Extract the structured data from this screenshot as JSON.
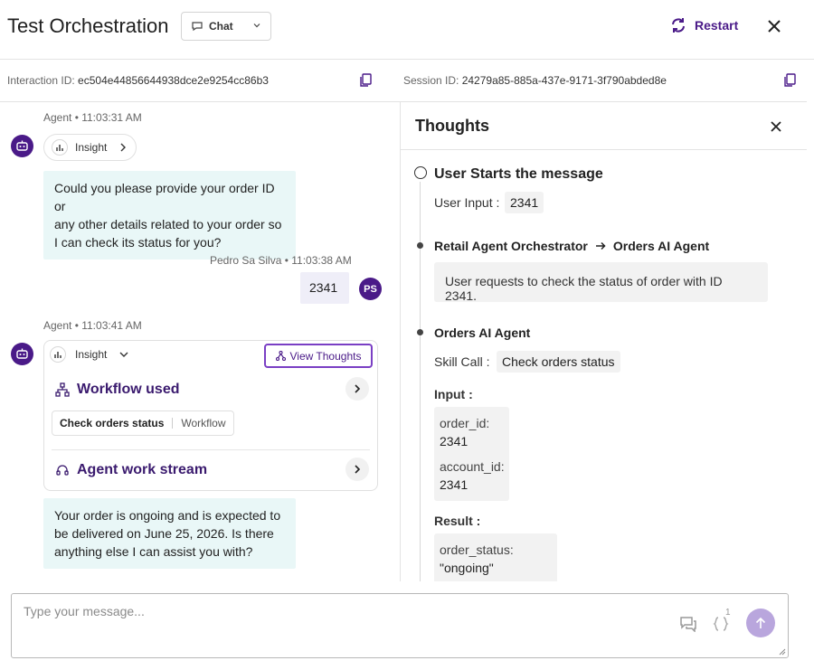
{
  "header": {
    "title": "Test Orchestration",
    "mode": "Chat",
    "restart_label": "Restart"
  },
  "ids": {
    "interaction_label": "Interaction ID:",
    "interaction_value": "ec504e44856644938dce2e9254cc86b3",
    "session_label": "Session ID:",
    "session_value": "24279a85-885a-437e-9171-3f790abded8e"
  },
  "chat": {
    "messages": [
      {
        "meta": "Agent • 11:03:31 AM",
        "insight_label": "Insight",
        "text_lines": [
          "Could you please provide your order ID or",
          "any other details related to your order so",
          "I can check its status for you?"
        ]
      },
      {
        "meta": "Pedro Sa Silva • 11:03:38 AM",
        "initials": "PS",
        "text": "2341"
      },
      {
        "meta": "Agent • 11:03:41 AM",
        "insight_label": "Insight",
        "view_thoughts_label": "View Thoughts",
        "workflow_title": "Workflow used",
        "workflow_name": "Check orders status",
        "workflow_kind": "Workflow",
        "stream_title": "Agent work stream",
        "text_lines": [
          "Your order is ongoing and is expected to",
          "be delivered on June 25, 2026. Is there",
          "anything else I can assist you with?"
        ]
      }
    ]
  },
  "thoughts": {
    "title": "Thoughts",
    "step1": {
      "title": "User Starts the message",
      "input_label": "User Input :",
      "input_value": "2341"
    },
    "step2": {
      "from": "Retail Agent Orchestrator",
      "to": "Orders AI Agent",
      "summary": "User requests to check the status of order with ID 2341."
    },
    "step3": {
      "title": "Orders AI Agent",
      "skill_label": "Skill Call :",
      "skill_value": "Check orders status",
      "input_label": "Input :",
      "params": [
        {
          "key": "order_id:",
          "value": "2341"
        },
        {
          "key": "account_id:",
          "value": "2341"
        }
      ],
      "result_label": "Result :",
      "result": {
        "key": "order_status:",
        "value": "\"ongoing\""
      }
    }
  },
  "composer": {
    "placeholder": "Type your message...",
    "vars_badge": "1"
  },
  "colors": {
    "brand": "#4a1a88",
    "agent_bubble": "#e9f7f7",
    "user_bubble": "#efeef8",
    "send_button": "#b9a6dd"
  }
}
